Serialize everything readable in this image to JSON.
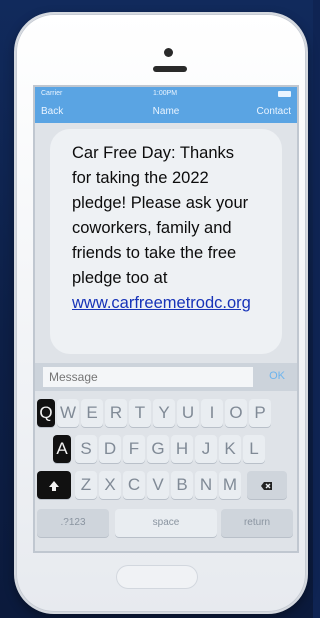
{
  "statusbar": {
    "carrier": "Carrier",
    "time": "1:00PM"
  },
  "navbar": {
    "back": "Back",
    "title": "Name",
    "contact": "Contact"
  },
  "message": {
    "lines": [
      "Car Free Day: Thanks",
      "for taking the 2022",
      "pledge! Please ask your",
      "coworkers, family and",
      "friends to take the free",
      "pledge too at"
    ],
    "link": "www.carfreemetrodc.org"
  },
  "composer": {
    "placeholder": "Message",
    "ok": "OK"
  },
  "keyboard": {
    "row1": [
      "Q",
      "W",
      "E",
      "R",
      "T",
      "Y",
      "U",
      "I",
      "O",
      "P"
    ],
    "row2": [
      "A",
      "S",
      "D",
      "F",
      "G",
      "H",
      "J",
      "K",
      "L"
    ],
    "row3": [
      "Z",
      "X",
      "C",
      "V",
      "B",
      "N",
      "M"
    ],
    "numbers": ".?123",
    "space": "space",
    "return": "return"
  },
  "colors": {
    "accent": "#5aa4e3",
    "link": "#1733b8",
    "background": "#0f2453"
  }
}
